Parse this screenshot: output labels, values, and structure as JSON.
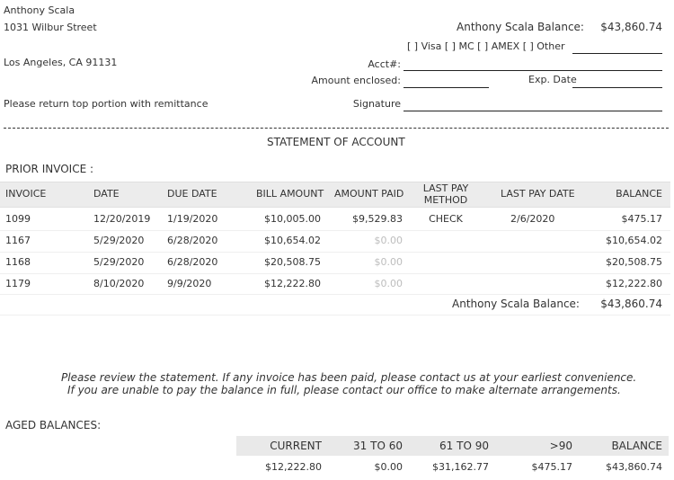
{
  "customer": {
    "name": "Anthony Scala",
    "address1": "1031 Wilbur Street",
    "address2": "Los Angeles, CA  91131"
  },
  "remit": {
    "balance_label": "Anthony Scala Balance:",
    "balance_value": "$43,860.74",
    "card_options": "[ ] Visa  [ ] MC  [ ] AMEX  [ ] Other",
    "acct_label": "Acct#:",
    "amount_label": "Amount enclosed:",
    "exp_label": "Exp. Date",
    "signature_label": "Signature",
    "return_note": "Please return top portion with remittance"
  },
  "statement": {
    "title": "STATEMENT OF ACCOUNT",
    "prior_label": "PRIOR INVOICE :",
    "columns": {
      "invoice": "INVOICE",
      "date": "DATE",
      "due": "DUE DATE",
      "bill": "BILL AMOUNT",
      "paid": "AMOUNT PAID",
      "method_line1": "LAST PAY",
      "method_line2": "METHOD",
      "lastdate": "LAST PAY DATE",
      "balance": "BALANCE"
    },
    "rows": [
      {
        "invoice": "1099",
        "date": "12/20/2019",
        "due": "1/19/2020",
        "bill": "$10,005.00",
        "paid": "$9,529.83",
        "method": "CHECK",
        "lastdate": "2/6/2020",
        "balance": "$475.17"
      },
      {
        "invoice": "1167",
        "date": "5/29/2020",
        "due": "6/28/2020",
        "bill": "$10,654.02",
        "paid": "$0.00",
        "method": "",
        "lastdate": "",
        "balance": "$10,654.02"
      },
      {
        "invoice": "1168",
        "date": "5/29/2020",
        "due": "6/28/2020",
        "bill": "$20,508.75",
        "paid": "$0.00",
        "method": "",
        "lastdate": "",
        "balance": "$20,508.75"
      },
      {
        "invoice": "1179",
        "date": "8/10/2020",
        "due": "9/9/2020",
        "bill": "$12,222.80",
        "paid": "$0.00",
        "method": "",
        "lastdate": "",
        "balance": "$12,222.80"
      }
    ],
    "total_label": "Anthony Scala Balance:",
    "total_value": "$43,860.74",
    "notice_line1": "Please review the statement. If any invoice has been paid, please contact us at your earliest convenience.",
    "notice_line2": "If you are unable to pay the balance in full, please contact our office to make alternate arrangements."
  },
  "aged": {
    "label": "AGED BALANCES:",
    "headers": {
      "current": "CURRENT",
      "d31_60": "31 TO 60",
      "d61_90": "61 TO 90",
      "over90": ">90",
      "balance": "BALANCE"
    },
    "values": {
      "current": "$12,222.80",
      "d31_60": "$0.00",
      "d61_90": "$31,162.77",
      "over90": "$475.17",
      "balance": "$43,860.74"
    }
  }
}
